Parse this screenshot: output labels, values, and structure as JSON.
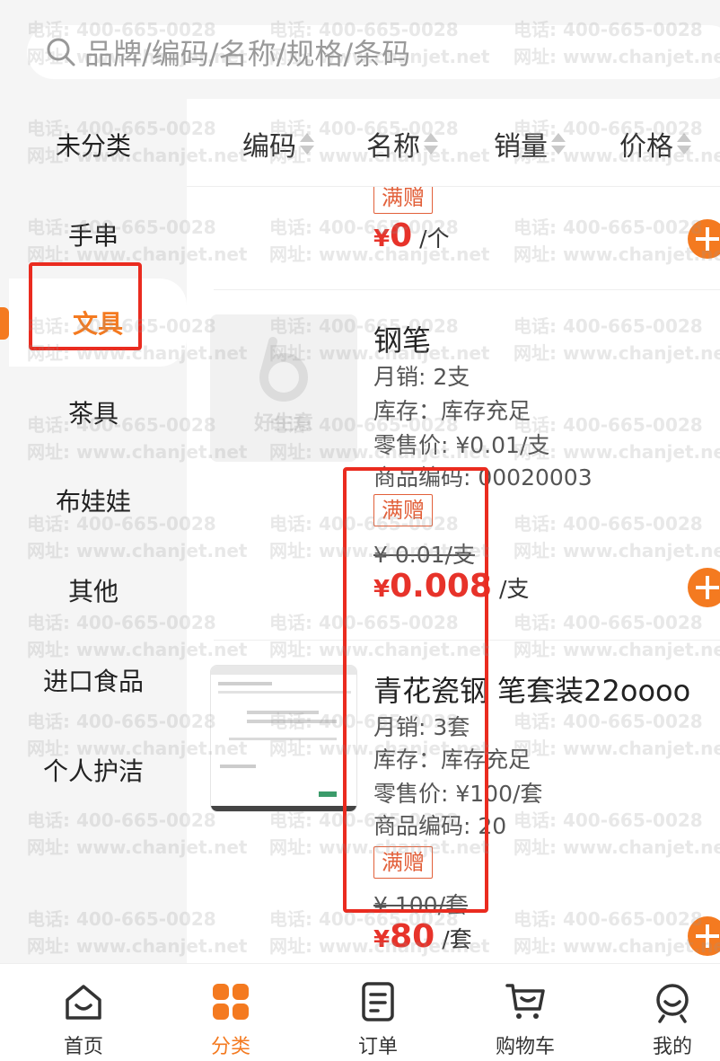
{
  "search": {
    "placeholder": "品牌/编码/名称/规格/条码"
  },
  "categories": [
    {
      "label": "未分类"
    },
    {
      "label": "手串"
    },
    {
      "label": "文具"
    },
    {
      "label": "茶具"
    },
    {
      "label": "布娃娃"
    },
    {
      "label": "其他"
    },
    {
      "label": "进口食品"
    },
    {
      "label": "个人护洁"
    }
  ],
  "active_category": "文具",
  "sort": [
    {
      "label": "编码"
    },
    {
      "label": "名称"
    },
    {
      "label": "销量"
    },
    {
      "label": "价格"
    }
  ],
  "products": [
    {
      "tag": "满赠",
      "price_symbol": "¥",
      "price": "0",
      "unit": "/个"
    },
    {
      "name": "钢笔",
      "sales": "月销: 2支",
      "stock": "库存：库存充足",
      "retail": "零售价: ¥0.01/支",
      "code": "商品编码: 00020003",
      "tag": "满赠",
      "original_price": "¥ 0.01/支",
      "price_symbol": "¥",
      "price": "0.008",
      "unit": "/支",
      "image_text": "好生意"
    },
    {
      "name": "青花瓷钢 笔套装22oooo",
      "sales": "月销: 3套",
      "stock": "库存：库存充足",
      "retail": "零售价: ¥100/套",
      "code": "商品编码: 20",
      "tag": "满赠",
      "original_price": "¥ 100/套",
      "price_symbol": "¥",
      "price": "80",
      "unit": "/套"
    }
  ],
  "tabbar": [
    {
      "label": "首页",
      "icon": "home-icon"
    },
    {
      "label": "分类",
      "icon": "category-icon"
    },
    {
      "label": "订单",
      "icon": "order-icon"
    },
    {
      "label": "购物车",
      "icon": "cart-icon"
    },
    {
      "label": "我的",
      "icon": "profile-icon"
    }
  ],
  "watermark": {
    "phone": "电话: 400-665-0028",
    "site": "网址: www.chanjet.net"
  },
  "colors": {
    "accent": "#f47a20",
    "price": "#e7332a",
    "tag": "#e2603a",
    "highlight_box": "#ea2b1f"
  }
}
